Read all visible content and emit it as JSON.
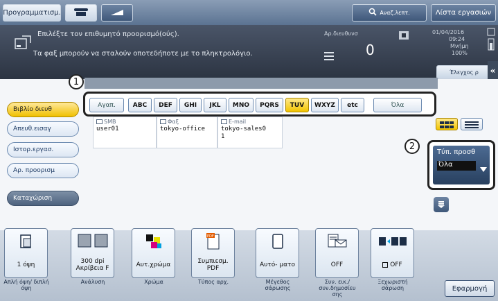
{
  "topbar": {
    "program_label": "Προγραμματισμ.",
    "search_label": "Αναζ.λεπτ.",
    "joblist_label": "Λίστα εργασιών"
  },
  "message": {
    "line1": "Επιλέξτε τον επιθυμητό προορισμό(ούς).",
    "line2": "Τα φαξ μπορούν να σταλούν οποτεδήποτε με το πληκτρολόγιο.",
    "dest_count_label": "Αρ.διευθυνσ",
    "dest_count": "0",
    "date": "01/04/2016",
    "time": "09:24",
    "memory_label": "Μνήμη",
    "memory_value": "100%",
    "check_label": "Έλεγχος ρ"
  },
  "sidebar": {
    "items": [
      {
        "label": "Βιβλίο διευθ"
      },
      {
        "label": "Απευθ.εισαγ"
      },
      {
        "label": "Ιστορ.εργασ."
      },
      {
        "label": "Αρ. προορισμ"
      },
      {
        "label": "Καταχώριση"
      }
    ]
  },
  "index_tabs": [
    {
      "label": "Αγαπ."
    },
    {
      "label": "ABC"
    },
    {
      "label": "DEF"
    },
    {
      "label": "GHI"
    },
    {
      "label": "JKL"
    },
    {
      "label": "MNO"
    },
    {
      "label": "PQRS"
    },
    {
      "label": "TUV"
    },
    {
      "label": "WXYZ"
    },
    {
      "label": "etc"
    },
    {
      "label": "Όλα"
    }
  ],
  "callouts": [
    "1",
    "2"
  ],
  "entries": [
    {
      "type": "SMB",
      "name": "user01"
    },
    {
      "type": "Φαξ",
      "name": "tokyo-office"
    },
    {
      "type": "E-mail",
      "name": "tokyo-sales0",
      "name2": "1"
    }
  ],
  "dest_type": {
    "label": "Τύπ. προσθ",
    "value": "Όλα"
  },
  "functions": [
    {
      "value": "1 όψη",
      "label": "Απλή όψη/ διπλή όψη"
    },
    {
      "value": "300 dpi",
      "value2": "Ακρίβεια F",
      "label": "Ανάλυση"
    },
    {
      "value": "Αυτ.χρώμα",
      "label": "Χρώμα"
    },
    {
      "value": "Συμπιεσμ.",
      "value2": "PDF",
      "label": "Τύπος αρχ."
    },
    {
      "value": "Αυτό- ματο",
      "label": "Μέγεθος σάρωσης"
    },
    {
      "value": "OFF",
      "label": "Συν. εικ./ συν.δημοσίευ σης"
    },
    {
      "value": "OFF",
      "label": "Ξεχωριστή σάρωση"
    }
  ],
  "apply_label": "Εφαρμογή",
  "colors": {
    "accent_yellow": "#f0c000",
    "nav_blue": "#4c6a92",
    "dark_bar": "#2c3442"
  }
}
